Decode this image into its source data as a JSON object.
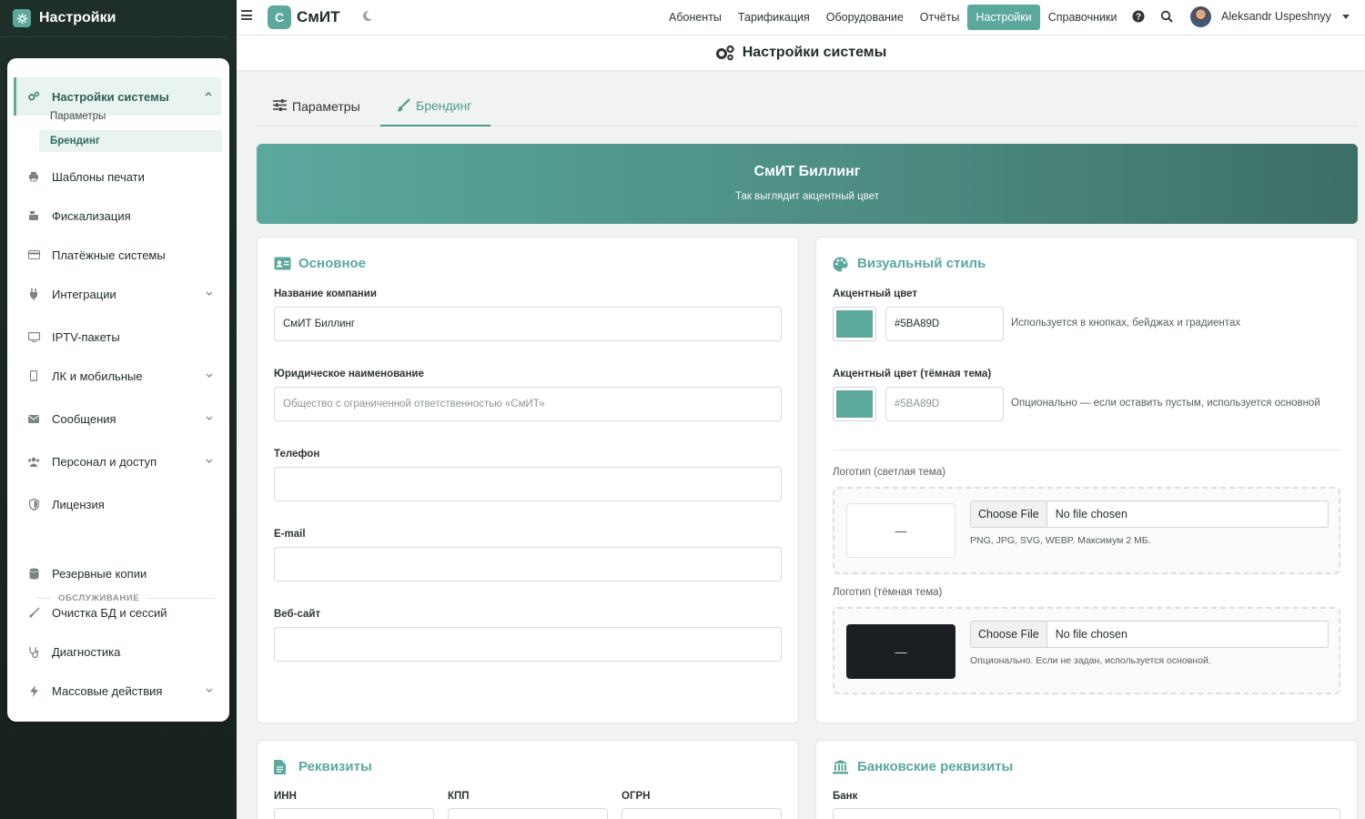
{
  "sidebar": {
    "title": "Настройки",
    "items": [
      {
        "label": "Настройки системы"
      },
      {
        "label": "Шаблоны печати"
      },
      {
        "label": "Фискализация"
      },
      {
        "label": "Платёжные системы"
      },
      {
        "label": "Интеграции"
      },
      {
        "label": "IPTV-пакеты"
      },
      {
        "label": "ЛК и мобильные"
      },
      {
        "label": "Сообщения"
      },
      {
        "label": "Персонал и доступ"
      },
      {
        "label": "Лицензия"
      },
      {
        "label": "Резервные копии"
      },
      {
        "label": "Очистка БД и сессий"
      },
      {
        "label": "Диагностика"
      },
      {
        "label": "Массовые действия"
      }
    ],
    "subitems": [
      {
        "label": "Параметры"
      },
      {
        "label": "Брендинг"
      }
    ],
    "section_label": "ОБСЛУЖИВАНИЕ"
  },
  "topbar": {
    "app_logo_letter": "С",
    "app_name": "СмИТ",
    "nav": [
      {
        "label": "Абоненты"
      },
      {
        "label": "Тарификация"
      },
      {
        "label": "Оборудование"
      },
      {
        "label": "Отчёты"
      },
      {
        "label": "Настройки"
      },
      {
        "label": "Справочники"
      }
    ],
    "active_nav": "Настройки",
    "user_name": "Aleksandr Uspeshnyy"
  },
  "page": {
    "title": "Настройки системы",
    "tabs": [
      {
        "label": "Параметры"
      },
      {
        "label": "Брендинг"
      }
    ],
    "active_tab": "Брендинг"
  },
  "banner": {
    "title": "СмИТ Биллинг",
    "subtitle": "Так выглядит акцентный цвет"
  },
  "basic": {
    "title": "Основное",
    "company_label": "Название компании",
    "company_value": "СмИТ Биллинг",
    "legal_label": "Юридическое наименование",
    "legal_placeholder": "Общество с ограниченной ответственностью «СмИТ»",
    "phone_label": "Телефон",
    "phone_value": "",
    "email_label": "E-mail",
    "email_value": "",
    "website_label": "Веб-сайт",
    "website_value": ""
  },
  "visual": {
    "title": "Визуальный стиль",
    "accent_label": "Акцентный цвет",
    "accent_value": "#5BA89D",
    "accent_hint": "Используется в кнопках, бейджах и градиентах",
    "accent_dark_label": "Акцентный цвет (тёмная тема)",
    "accent_dark_placeholder": "#5BA89D",
    "accent_dark_hint": "Опционально — если оставить пустым, используется основной",
    "logo_light_label": "Логотип (светлая тема)",
    "logo_light_preview": "—",
    "logo_light_note": "PNG, JPG, SVG, WEBP. Максимум 2 МБ.",
    "logo_dark_label": "Логотип (тёмная тема)",
    "logo_dark_preview": "—",
    "logo_dark_note": "Опционально. Если не задан, используется основной.",
    "choose_file": "Choose File",
    "no_file": "No file chosen"
  },
  "requisites": {
    "title": "Реквизиты",
    "inn_label": "ИНН",
    "kpp_label": "КПП",
    "ogrn_label": "ОГРН"
  },
  "bank": {
    "title": "Банковские реквизиты",
    "bank_label": "Банк"
  },
  "colors": {
    "accent": "#5BA89D",
    "sidebar_dark": "#1e2e28"
  }
}
